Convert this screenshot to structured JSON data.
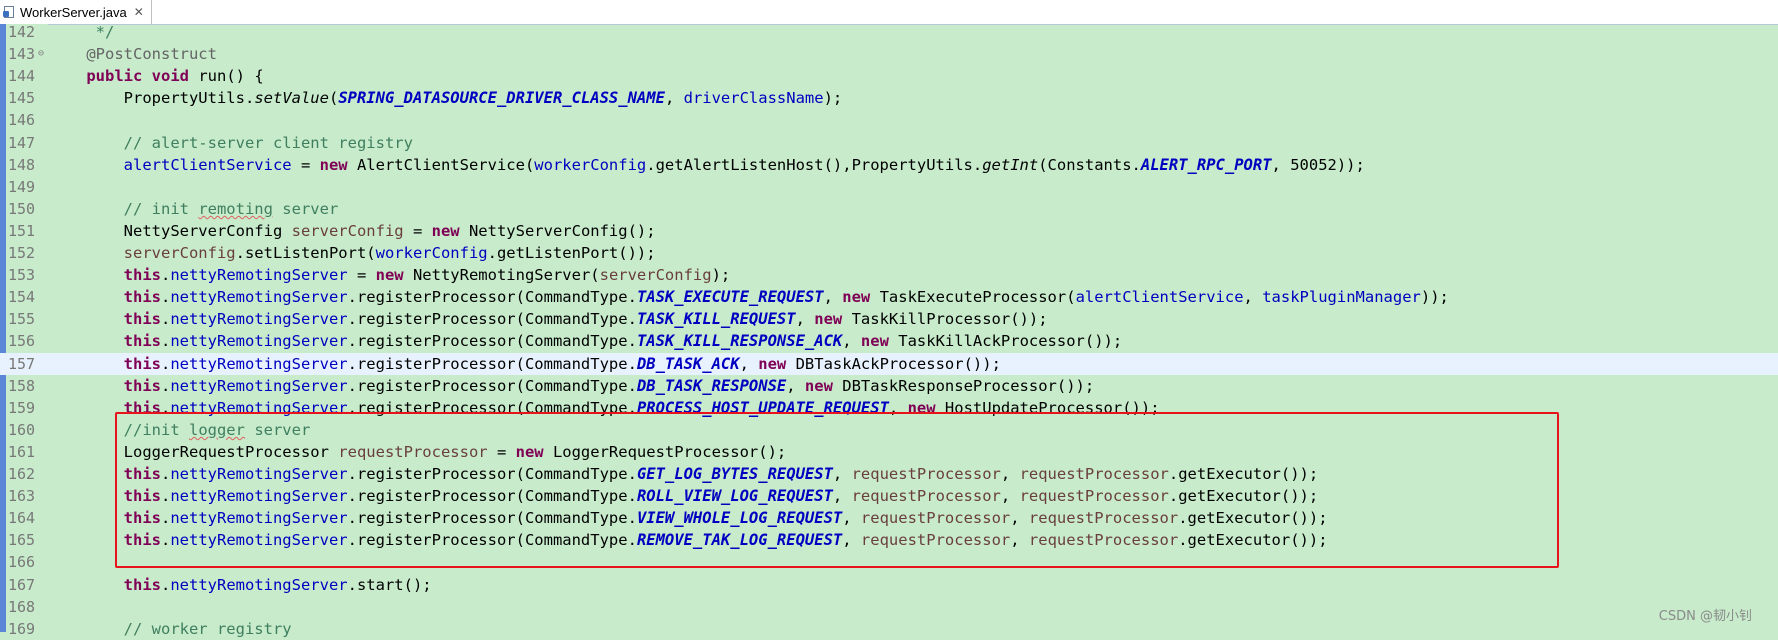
{
  "tab": {
    "filename": "WorkerServer.java",
    "close_symbol": "✕"
  },
  "watermark": "CSDN @韧小钊",
  "lines": [
    {
      "num": "142",
      "fold": "",
      "tokens": [
        [
          "p",
          "     "
        ],
        [
          "cmt",
          "*/"
        ]
      ]
    },
    {
      "num": "143",
      "fold": "⊖",
      "tokens": [
        [
          "p",
          "    "
        ],
        [
          "ann",
          "@PostConstruct"
        ]
      ]
    },
    {
      "num": "144",
      "fold": "",
      "tokens": [
        [
          "p",
          "    "
        ],
        [
          "kw",
          "public"
        ],
        [
          "p",
          " "
        ],
        [
          "kw",
          "void"
        ],
        [
          "p",
          " run() {"
        ]
      ]
    },
    {
      "num": "145",
      "fold": "",
      "tokens": [
        [
          "p",
          "        PropertyUtils."
        ],
        [
          "sm",
          "setValue"
        ],
        [
          "p",
          "("
        ],
        [
          "cst",
          "SPRING_DATASOURCE_DRIVER_CLASS_NAME"
        ],
        [
          "p",
          ", "
        ],
        [
          "fld",
          "driverClassName"
        ],
        [
          "p",
          ");"
        ]
      ]
    },
    {
      "num": "146",
      "fold": "",
      "tokens": []
    },
    {
      "num": "147",
      "fold": "",
      "tokens": [
        [
          "p",
          "        "
        ],
        [
          "cmt",
          "// alert-server client registry"
        ]
      ]
    },
    {
      "num": "148",
      "fold": "",
      "tokens": [
        [
          "p",
          "        "
        ],
        [
          "fld",
          "alertClientService"
        ],
        [
          "p",
          " = "
        ],
        [
          "kw",
          "new"
        ],
        [
          "p",
          " AlertClientService("
        ],
        [
          "fld",
          "workerConfig"
        ],
        [
          "p",
          ".getAlertListenHost(),PropertyUtils."
        ],
        [
          "sm",
          "getInt"
        ],
        [
          "p",
          "(Constants."
        ],
        [
          "cst",
          "ALERT_RPC_PORT"
        ],
        [
          "p",
          ", 50052));"
        ]
      ]
    },
    {
      "num": "149",
      "fold": "",
      "tokens": []
    },
    {
      "num": "150",
      "fold": "",
      "tokens": [
        [
          "p",
          "        "
        ],
        [
          "cmt",
          "// init "
        ],
        [
          "cmtsq",
          "remoting"
        ],
        [
          "cmt",
          " server"
        ]
      ]
    },
    {
      "num": "151",
      "fold": "",
      "tokens": [
        [
          "p",
          "        NettyServerConfig "
        ],
        [
          "lv",
          "serverConfig"
        ],
        [
          "p",
          " = "
        ],
        [
          "kw",
          "new"
        ],
        [
          "p",
          " NettyServerConfig();"
        ]
      ]
    },
    {
      "num": "152",
      "fold": "",
      "tokens": [
        [
          "p",
          "        "
        ],
        [
          "lv",
          "serverConfig"
        ],
        [
          "p",
          ".setListenPort("
        ],
        [
          "fld",
          "workerConfig"
        ],
        [
          "p",
          ".getListenPort());"
        ]
      ]
    },
    {
      "num": "153",
      "fold": "",
      "tokens": [
        [
          "p",
          "        "
        ],
        [
          "kw",
          "this"
        ],
        [
          "p",
          "."
        ],
        [
          "fld",
          "nettyRemotingServer"
        ],
        [
          "p",
          " = "
        ],
        [
          "kw",
          "new"
        ],
        [
          "p",
          " NettyRemotingServer("
        ],
        [
          "lv",
          "serverConfig"
        ],
        [
          "p",
          ");"
        ]
      ]
    },
    {
      "num": "154",
      "fold": "",
      "tokens": [
        [
          "p",
          "        "
        ],
        [
          "kw",
          "this"
        ],
        [
          "p",
          "."
        ],
        [
          "fld",
          "nettyRemotingServer"
        ],
        [
          "p",
          ".registerProcessor(CommandType."
        ],
        [
          "cst",
          "TASK_EXECUTE_REQUEST"
        ],
        [
          "p",
          ", "
        ],
        [
          "kw",
          "new"
        ],
        [
          "p",
          " TaskExecuteProcessor("
        ],
        [
          "fld",
          "alertClientService"
        ],
        [
          "p",
          ", "
        ],
        [
          "fld",
          "taskPluginManager"
        ],
        [
          "p",
          "));"
        ]
      ]
    },
    {
      "num": "155",
      "fold": "",
      "tokens": [
        [
          "p",
          "        "
        ],
        [
          "kw",
          "this"
        ],
        [
          "p",
          "."
        ],
        [
          "fld",
          "nettyRemotingServer"
        ],
        [
          "p",
          ".registerProcessor(CommandType."
        ],
        [
          "cst",
          "TASK_KILL_REQUEST"
        ],
        [
          "p",
          ", "
        ],
        [
          "kw",
          "new"
        ],
        [
          "p",
          " TaskKillProcessor());"
        ]
      ]
    },
    {
      "num": "156",
      "fold": "",
      "tokens": [
        [
          "p",
          "        "
        ],
        [
          "kw",
          "this"
        ],
        [
          "p",
          "."
        ],
        [
          "fld",
          "nettyRemotingServer"
        ],
        [
          "p",
          ".registerProcessor(CommandType."
        ],
        [
          "cst",
          "TASK_KILL_RESPONSE_ACK"
        ],
        [
          "p",
          ", "
        ],
        [
          "kw",
          "new"
        ],
        [
          "p",
          " TaskKillAckProcessor());"
        ]
      ]
    },
    {
      "num": "157",
      "fold": "",
      "current": true,
      "tokens": [
        [
          "p",
          "        "
        ],
        [
          "kw",
          "this"
        ],
        [
          "p",
          "."
        ],
        [
          "fld",
          "nettyRemotingServer"
        ],
        [
          "p",
          ".registerProcessor(CommandType."
        ],
        [
          "cst",
          "DB_TASK_ACK"
        ],
        [
          "p",
          ", "
        ],
        [
          "kw",
          "new"
        ],
        [
          "p",
          " DBTaskAckProcessor());"
        ]
      ]
    },
    {
      "num": "158",
      "fold": "",
      "tokens": [
        [
          "p",
          "        "
        ],
        [
          "kw",
          "this"
        ],
        [
          "p",
          "."
        ],
        [
          "fld",
          "nettyRemotingServer"
        ],
        [
          "p",
          ".registerProcessor(CommandType."
        ],
        [
          "cst",
          "DB_TASK_RESPONSE"
        ],
        [
          "p",
          ", "
        ],
        [
          "kw",
          "new"
        ],
        [
          "p",
          " DBTaskResponseProcessor());"
        ]
      ]
    },
    {
      "num": "159",
      "fold": "",
      "tokens": [
        [
          "p",
          "        "
        ],
        [
          "kw",
          "this"
        ],
        [
          "p",
          "."
        ],
        [
          "fld",
          "nettyRemotingServer"
        ],
        [
          "p",
          ".registerProcessor(CommandType."
        ],
        [
          "cst",
          "PROCESS_HOST_UPDATE_REQUEST"
        ],
        [
          "p",
          ", "
        ],
        [
          "kw",
          "new"
        ],
        [
          "p",
          " HostUpdateProcessor());"
        ]
      ]
    },
    {
      "num": "160",
      "fold": "",
      "tokens": [
        [
          "p",
          "        "
        ],
        [
          "cmt",
          "//init "
        ],
        [
          "cmtsq",
          "logger"
        ],
        [
          "cmt",
          " server"
        ]
      ]
    },
    {
      "num": "161",
      "fold": "",
      "tokens": [
        [
          "p",
          "        LoggerRequestProcessor "
        ],
        [
          "lv",
          "requestProcessor"
        ],
        [
          "p",
          " = "
        ],
        [
          "kw",
          "new"
        ],
        [
          "p",
          " LoggerRequestProcessor();"
        ]
      ]
    },
    {
      "num": "162",
      "fold": "",
      "tokens": [
        [
          "p",
          "        "
        ],
        [
          "kw",
          "this"
        ],
        [
          "p",
          "."
        ],
        [
          "fld",
          "nettyRemotingServer"
        ],
        [
          "p",
          ".registerProcessor(CommandType."
        ],
        [
          "cst",
          "GET_LOG_BYTES_REQUEST"
        ],
        [
          "p",
          ", "
        ],
        [
          "lv",
          "requestProcessor"
        ],
        [
          "p",
          ", "
        ],
        [
          "lv",
          "requestProcessor"
        ],
        [
          "p",
          ".getExecutor());"
        ]
      ]
    },
    {
      "num": "163",
      "fold": "",
      "tokens": [
        [
          "p",
          "        "
        ],
        [
          "kw",
          "this"
        ],
        [
          "p",
          "."
        ],
        [
          "fld",
          "nettyRemotingServer"
        ],
        [
          "p",
          ".registerProcessor(CommandType."
        ],
        [
          "cst",
          "ROLL_VIEW_LOG_REQUEST"
        ],
        [
          "p",
          ", "
        ],
        [
          "lv",
          "requestProcessor"
        ],
        [
          "p",
          ", "
        ],
        [
          "lv",
          "requestProcessor"
        ],
        [
          "p",
          ".getExecutor());"
        ]
      ]
    },
    {
      "num": "164",
      "fold": "",
      "tokens": [
        [
          "p",
          "        "
        ],
        [
          "kw",
          "this"
        ],
        [
          "p",
          "."
        ],
        [
          "fld",
          "nettyRemotingServer"
        ],
        [
          "p",
          ".registerProcessor(CommandType."
        ],
        [
          "cst",
          "VIEW_WHOLE_LOG_REQUEST"
        ],
        [
          "p",
          ", "
        ],
        [
          "lv",
          "requestProcessor"
        ],
        [
          "p",
          ", "
        ],
        [
          "lv",
          "requestProcessor"
        ],
        [
          "p",
          ".getExecutor());"
        ]
      ]
    },
    {
      "num": "165",
      "fold": "",
      "tokens": [
        [
          "p",
          "        "
        ],
        [
          "kw",
          "this"
        ],
        [
          "p",
          "."
        ],
        [
          "fld",
          "nettyRemotingServer"
        ],
        [
          "p",
          ".registerProcessor(CommandType."
        ],
        [
          "cst",
          "REMOVE_TAK_LOG_REQUEST"
        ],
        [
          "p",
          ", "
        ],
        [
          "lv",
          "requestProcessor"
        ],
        [
          "p",
          ", "
        ],
        [
          "lv",
          "requestProcessor"
        ],
        [
          "p",
          ".getExecutor());"
        ]
      ]
    },
    {
      "num": "166",
      "fold": "",
      "tokens": []
    },
    {
      "num": "167",
      "fold": "",
      "tokens": [
        [
          "p",
          "        "
        ],
        [
          "kw",
          "this"
        ],
        [
          "p",
          "."
        ],
        [
          "fld",
          "nettyRemotingServer"
        ],
        [
          "p",
          ".start();"
        ]
      ]
    },
    {
      "num": "168",
      "fold": "",
      "tokens": []
    },
    {
      "num": "169",
      "fold": "",
      "tokens": [
        [
          "p",
          "        "
        ],
        [
          "cmt",
          "// worker registry"
        ]
      ]
    }
  ]
}
